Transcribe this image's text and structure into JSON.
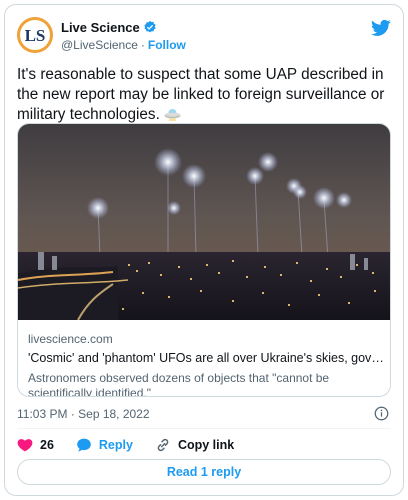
{
  "author": {
    "display_name": "Live Science",
    "handle": "@LiveScience",
    "separator": "·",
    "follow_label": "Follow",
    "avatar_text": "LS"
  },
  "tweet": {
    "text": "It's reasonable to suspect that some UAP described in the new report may be linked to foreign surveillance or military technologies.",
    "emoji_icon": "flying-saucer-icon"
  },
  "link_card": {
    "domain": "livescience.com",
    "title": "'Cosmic' and 'phantom' UFOs are all over Ukraine's skies, government re...",
    "description": "Astronomers observed dozens of objects that \"cannot be scientifically identified.\""
  },
  "meta": {
    "timestamp": "11:03 PM · Sep 18, 2022"
  },
  "actions": {
    "like_count": "26",
    "reply_label": "Reply",
    "copy_link_label": "Copy link"
  },
  "replies": {
    "read_label": "Read 1 reply"
  },
  "colors": {
    "accent": "#1d9bf0",
    "like": "#f91880",
    "text_secondary": "#536471",
    "border": "#cfd9de"
  }
}
